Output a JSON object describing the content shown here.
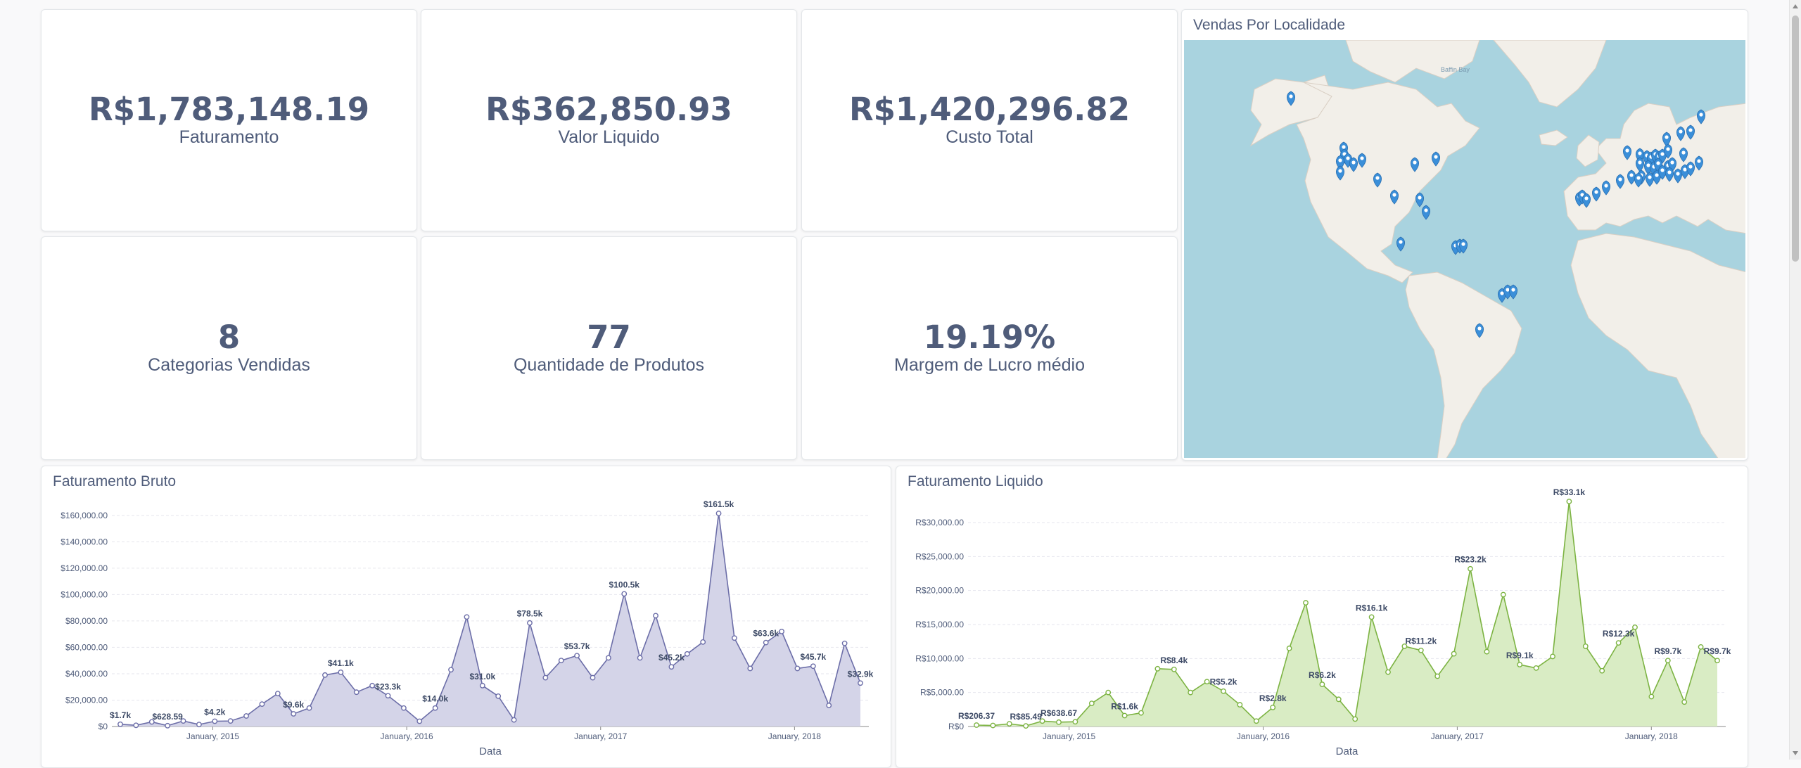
{
  "kpis": {
    "faturamento": {
      "value": "R$1,783,148.19",
      "label": "Faturamento"
    },
    "valor_liquido": {
      "value": "R$362,850.93",
      "label": "Valor Liquido"
    },
    "custo_total": {
      "value": "R$1,420,296.82",
      "label": "Custo Total"
    },
    "categorias": {
      "value": "8",
      "label": "Categorias Vendidas"
    },
    "produtos": {
      "value": "77",
      "label": "Quantidade de Produtos"
    },
    "margem": {
      "value": "19.19%",
      "label": "Margem de Lucro médio"
    }
  },
  "map": {
    "title": "Vendas Por Localidade",
    "sea_labels": [
      "Baffin Bay"
    ],
    "marker_color": "#3b8fd9"
  },
  "chart_data": [
    {
      "type": "area",
      "title": "Faturamento Bruto",
      "xlabel": "Data",
      "ylabel": "",
      "color": "#6c6ea8",
      "fill": "#d4d4e8",
      "x_ticks": [
        "January, 2015",
        "January, 2016",
        "January, 2017",
        "January, 2018"
      ],
      "y_ticks": [
        "$0",
        "$20,000.00",
        "$40,000.00",
        "$60,000.00",
        "$80,000.00",
        "$100,000.00",
        "$120,000.00",
        "$140,000.00",
        "$160,000.00"
      ],
      "ylim": [
        0,
        170000
      ],
      "values": [
        1700,
        900,
        3500,
        628.59,
        4200,
        1500,
        4000,
        4200,
        8000,
        17000,
        25000,
        9600,
        14000,
        39000,
        41100,
        26000,
        31000,
        23300,
        14000,
        4000,
        14000,
        43000,
        83000,
        31000,
        23000,
        5000,
        78500,
        37000,
        50000,
        53700,
        37000,
        52000,
        100500,
        52000,
        84000,
        45200,
        55000,
        64000,
        161500,
        67000,
        44000,
        63600,
        72000,
        44000,
        45700,
        16000,
        63000,
        32900
      ],
      "labels": [
        {
          "i": 0,
          "text": "$1.7k"
        },
        {
          "i": 3,
          "text": "$628.59"
        },
        {
          "i": 6,
          "text": "$4.2k"
        },
        {
          "i": 11,
          "text": "$9.6k"
        },
        {
          "i": 14,
          "text": "$41.1k"
        },
        {
          "i": 17,
          "text": "$23.3k"
        },
        {
          "i": 20,
          "text": "$14.0k"
        },
        {
          "i": 23,
          "text": "$31.0k"
        },
        {
          "i": 26,
          "text": "$78.5k"
        },
        {
          "i": 29,
          "text": "$53.7k"
        },
        {
          "i": 32,
          "text": "$100.5k"
        },
        {
          "i": 35,
          "text": "$45.2k"
        },
        {
          "i": 38,
          "text": "$161.5k"
        },
        {
          "i": 41,
          "text": "$63.6k"
        },
        {
          "i": 44,
          "text": "$45.7k"
        },
        {
          "i": 47,
          "text": "$32.9k"
        }
      ]
    },
    {
      "type": "area",
      "title": "Faturamento Liquido",
      "xlabel": "Data",
      "ylabel": "",
      "color": "#7cb342",
      "fill": "#d9ecc4",
      "x_ticks": [
        "January, 2015",
        "January, 2016",
        "January, 2017",
        "January, 2018"
      ],
      "y_ticks": [
        "R$0",
        "R$5,000.00",
        "R$10,000.00",
        "R$15,000.00",
        "R$20,000.00",
        "R$25,000.00",
        "R$30,000.00"
      ],
      "ylim": [
        0,
        33000
      ],
      "values": [
        206.37,
        150,
        400,
        85.49,
        800,
        638.67,
        700,
        3400,
        5000,
        1600,
        2000,
        8500,
        8400,
        5000,
        6600,
        5200,
        3200,
        800,
        2800,
        11500,
        18200,
        6200,
        4000,
        1100,
        16100,
        8000,
        11800,
        11200,
        7400,
        10700,
        23200,
        11000,
        19400,
        9100,
        8600,
        10300,
        33100,
        11800,
        8200,
        12300,
        14600,
        4400,
        9700,
        3600,
        11700,
        9700
      ],
      "labels": [
        {
          "i": 0,
          "text": "R$206.37"
        },
        {
          "i": 3,
          "text": "R$85.49"
        },
        {
          "i": 5,
          "text": "R$638.67"
        },
        {
          "i": 9,
          "text": "R$1.6k"
        },
        {
          "i": 12,
          "text": "R$8.4k"
        },
        {
          "i": 15,
          "text": "R$5.2k"
        },
        {
          "i": 18,
          "text": "R$2.8k"
        },
        {
          "i": 21,
          "text": "R$6.2k"
        },
        {
          "i": 24,
          "text": "R$16.1k"
        },
        {
          "i": 27,
          "text": "R$11.2k"
        },
        {
          "i": 30,
          "text": "R$23.2k"
        },
        {
          "i": 33,
          "text": "R$9.1k"
        },
        {
          "i": 36,
          "text": "R$33.1k"
        },
        {
          "i": 39,
          "text": "R$12.3k"
        },
        {
          "i": 42,
          "text": "R$9.7k"
        },
        {
          "i": 45,
          "text": "R$9.7k"
        }
      ]
    }
  ]
}
